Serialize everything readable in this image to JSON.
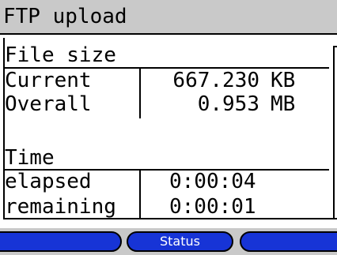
{
  "window": {
    "title": "FTP upload"
  },
  "file_size": {
    "heading": "File size",
    "rows": [
      {
        "label": "Current",
        "value": "667.230",
        "unit": "KB"
      },
      {
        "label": "Overall",
        "value": "0.953",
        "unit": "MB"
      }
    ]
  },
  "time": {
    "heading": "Time",
    "rows": [
      {
        "label": "elapsed",
        "value": "0:00:04"
      },
      {
        "label": "remaining",
        "value": "0:00:01"
      }
    ]
  },
  "softkeys": [
    {
      "label": ""
    },
    {
      "label": "Status"
    },
    {
      "label": ""
    }
  ],
  "colors": {
    "title_bar": "#c9c9c9",
    "softkey_fill": "#1734d6",
    "softkey_text": "#ffffff"
  }
}
